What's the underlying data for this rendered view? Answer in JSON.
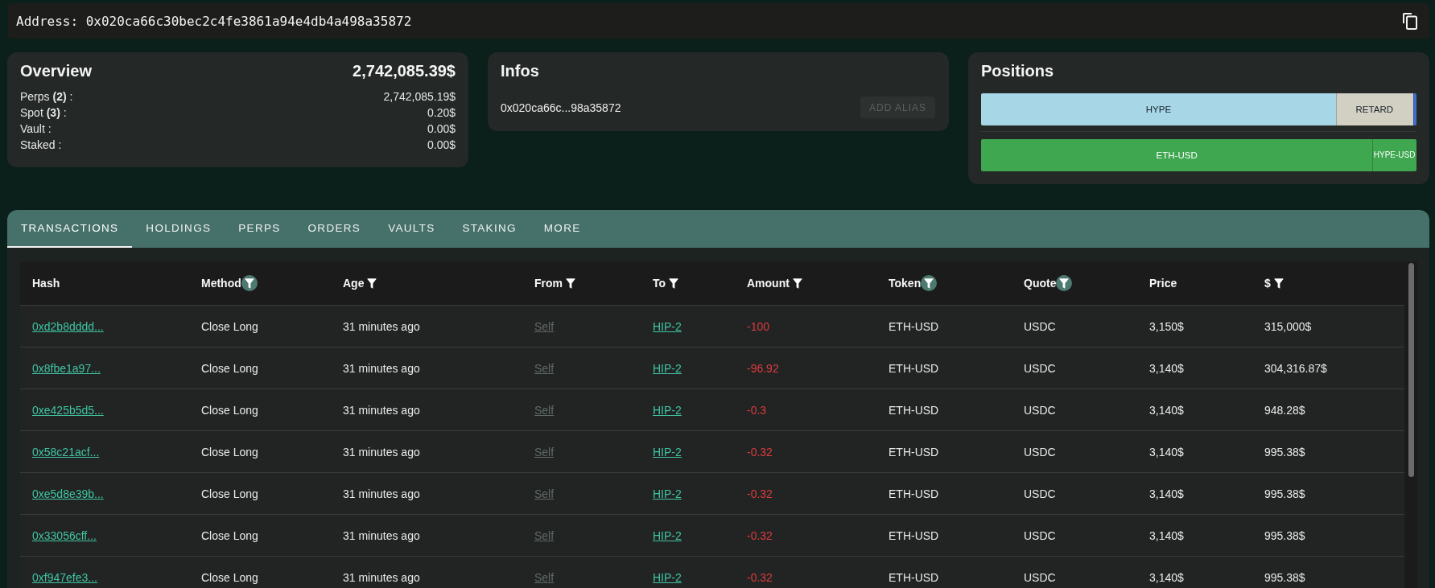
{
  "address_bar": {
    "text": "Address: 0x020ca66c30bec2c4fe3861a94e4db4a498a35872"
  },
  "overview": {
    "title": "Overview",
    "total": "2,742,085.39$",
    "rows": [
      {
        "label": "Perps **(2)** :",
        "value": "2,742,085.19$"
      },
      {
        "label": "Spot **(3)** :",
        "value": "0.20$"
      },
      {
        "label": "Vault :",
        "value": "0.00$"
      },
      {
        "label": "Staked :",
        "value": "0.00$"
      }
    ]
  },
  "infos": {
    "title": "Infos",
    "address": "0x020ca66c...98a35872",
    "button": {
      "label": "ADD ALIAS",
      "disabled": true
    }
  },
  "positions": {
    "title": "Positions",
    "bars": [
      {
        "segments": [
          {
            "label": "HYPE",
            "color": "#a7d6e7",
            "level": 0.815
          },
          {
            "label": "RETARD",
            "color": "#d2cfc3",
            "level": 0.177
          },
          {
            "color": "#3d6fd1",
            "level": 0.008
          }
        ]
      },
      {
        "segments": [
          {
            "label": "ETH-USD",
            "color": "#3ea74f",
            "level": 0.899
          },
          {
            "label": "HYPE-USD",
            "color": "#3ea74f",
            "level": 0.101
          }
        ]
      }
    ]
  },
  "tabs": [
    {
      "label": "TRANSACTIONS",
      "selected": true
    },
    {
      "label": "HOLDINGS",
      "selected": false
    },
    {
      "label": "PERPS",
      "selected": false
    },
    {
      "label": "ORDERS",
      "selected": false
    },
    {
      "label": "VAULTS",
      "selected": false
    },
    {
      "label": "STAKING",
      "selected": false
    },
    {
      "label": "MORE",
      "selected": false
    }
  ],
  "table": {
    "columns": [
      {
        "label": "Hash",
        "filterable": false
      },
      {
        "label": "Method",
        "filterable": true,
        "filter_active": true
      },
      {
        "label": "Age",
        "filterable": true,
        "filter_active": false
      },
      {
        "label": "From",
        "filterable": true,
        "filter_active": false
      },
      {
        "label": "To",
        "filterable": true,
        "filter_active": false
      },
      {
        "label": "Amount",
        "filterable": true,
        "filter_active": false
      },
      {
        "label": "Token",
        "filterable": true,
        "filter_active": true
      },
      {
        "label": "Quote",
        "filterable": true,
        "filter_active": true
      },
      {
        "label": "Price",
        "filterable": false
      },
      {
        "label": "$",
        "filterable": true,
        "filter_active": false
      }
    ],
    "rows": [
      {
        "cells": [
          {
            "text": "0xd2b8dddd...",
            "kind": "link"
          },
          {
            "text": "Close Long",
            "kind": "plain"
          },
          {
            "text": "31 minutes ago",
            "kind": "plain"
          },
          {
            "text": "Self",
            "kind": "muted"
          },
          {
            "text": "HIP-2",
            "kind": "link"
          },
          {
            "text": "-100",
            "kind": "negative"
          },
          {
            "text": "ETH-USD",
            "kind": "plain"
          },
          {
            "text": "USDC",
            "kind": "plain"
          },
          {
            "text": "3,150$",
            "kind": "plain"
          },
          {
            "text": "315,000$",
            "kind": "plain"
          }
        ]
      },
      {
        "cells": [
          {
            "text": "0x8fbe1a97...",
            "kind": "link"
          },
          {
            "text": "Close Long",
            "kind": "plain"
          },
          {
            "text": "31 minutes ago",
            "kind": "plain"
          },
          {
            "text": "Self",
            "kind": "muted"
          },
          {
            "text": "HIP-2",
            "kind": "link"
          },
          {
            "text": "-96.92",
            "kind": "negative"
          },
          {
            "text": "ETH-USD",
            "kind": "plain"
          },
          {
            "text": "USDC",
            "kind": "plain"
          },
          {
            "text": "3,140$",
            "kind": "plain"
          },
          {
            "text": "304,316.87$",
            "kind": "plain"
          }
        ]
      },
      {
        "cells": [
          {
            "text": "0xe425b5d5...",
            "kind": "link"
          },
          {
            "text": "Close Long",
            "kind": "plain"
          },
          {
            "text": "31 minutes ago",
            "kind": "plain"
          },
          {
            "text": "Self",
            "kind": "muted"
          },
          {
            "text": "HIP-2",
            "kind": "link"
          },
          {
            "text": "-0.3",
            "kind": "negative"
          },
          {
            "text": "ETH-USD",
            "kind": "plain"
          },
          {
            "text": "USDC",
            "kind": "plain"
          },
          {
            "text": "3,140$",
            "kind": "plain"
          },
          {
            "text": "948.28$",
            "kind": "plain"
          }
        ]
      },
      {
        "cells": [
          {
            "text": "0x58c21acf...",
            "kind": "link"
          },
          {
            "text": "Close Long",
            "kind": "plain"
          },
          {
            "text": "31 minutes ago",
            "kind": "plain"
          },
          {
            "text": "Self",
            "kind": "muted"
          },
          {
            "text": "HIP-2",
            "kind": "link"
          },
          {
            "text": "-0.32",
            "kind": "negative"
          },
          {
            "text": "ETH-USD",
            "kind": "plain"
          },
          {
            "text": "USDC",
            "kind": "plain"
          },
          {
            "text": "3,140$",
            "kind": "plain"
          },
          {
            "text": "995.38$",
            "kind": "plain"
          }
        ]
      },
      {
        "cells": [
          {
            "text": "0xe5d8e39b...",
            "kind": "link"
          },
          {
            "text": "Close Long",
            "kind": "plain"
          },
          {
            "text": "31 minutes ago",
            "kind": "plain"
          },
          {
            "text": "Self",
            "kind": "muted"
          },
          {
            "text": "HIP-2",
            "kind": "link"
          },
          {
            "text": "-0.32",
            "kind": "negative"
          },
          {
            "text": "ETH-USD",
            "kind": "plain"
          },
          {
            "text": "USDC",
            "kind": "plain"
          },
          {
            "text": "3,140$",
            "kind": "plain"
          },
          {
            "text": "995.38$",
            "kind": "plain"
          }
        ]
      },
      {
        "cells": [
          {
            "text": "0x33056cff...",
            "kind": "link"
          },
          {
            "text": "Close Long",
            "kind": "plain"
          },
          {
            "text": "31 minutes ago",
            "kind": "plain"
          },
          {
            "text": "Self",
            "kind": "muted"
          },
          {
            "text": "HIP-2",
            "kind": "link"
          },
          {
            "text": "-0.32",
            "kind": "negative"
          },
          {
            "text": "ETH-USD",
            "kind": "plain"
          },
          {
            "text": "USDC",
            "kind": "plain"
          },
          {
            "text": "3,140$",
            "kind": "plain"
          },
          {
            "text": "995.38$",
            "kind": "plain"
          }
        ]
      },
      {
        "cells": [
          {
            "text": "0xf947efe3...",
            "kind": "link"
          },
          {
            "text": "Close Long",
            "kind": "plain"
          },
          {
            "text": "31 minutes ago",
            "kind": "plain"
          },
          {
            "text": "Self",
            "kind": "muted"
          },
          {
            "text": "HIP-2",
            "kind": "link"
          },
          {
            "text": "-0.32",
            "kind": "negative"
          },
          {
            "text": "ETH-USD",
            "kind": "plain"
          },
          {
            "text": "USDC",
            "kind": "plain"
          },
          {
            "text": "3,140$",
            "kind": "plain"
          },
          {
            "text": "995.38$",
            "kind": "plain"
          }
        ]
      }
    ]
  }
}
